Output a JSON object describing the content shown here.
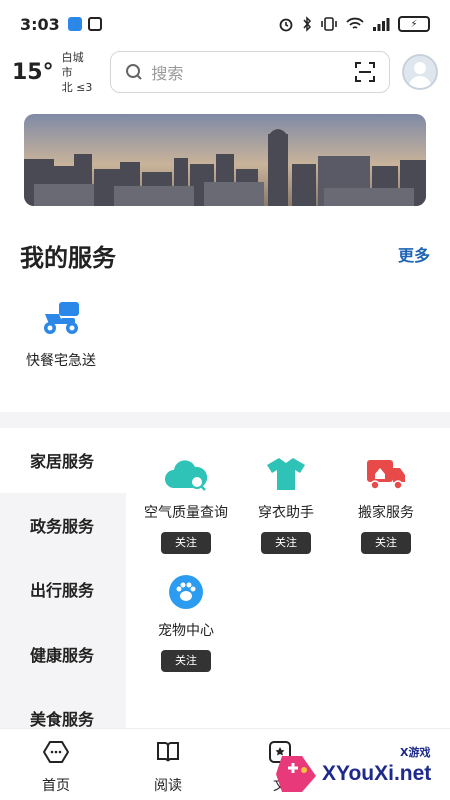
{
  "status_bar": {
    "time": "3:03",
    "battery": "⚡"
  },
  "header": {
    "temperature": "15°",
    "city": "白城市",
    "wind": "北 ≤3",
    "search_placeholder": "搜索"
  },
  "my_services": {
    "title": "我的服务",
    "more_label": "更多",
    "items": [
      {
        "label": "快餐宅急送",
        "icon": "delivery-scooter-icon"
      }
    ]
  },
  "categories": {
    "items": [
      {
        "label": "家居服务",
        "active": true
      },
      {
        "label": "政务服务",
        "active": false
      },
      {
        "label": "出行服务",
        "active": false
      },
      {
        "label": "健康服务",
        "active": false
      },
      {
        "label": "美食服务",
        "active": false
      }
    ]
  },
  "service_grid": {
    "follow_label": "关注",
    "items": [
      {
        "label": "空气质量查询",
        "icon": "air-quality-icon"
      },
      {
        "label": "穿衣助手",
        "icon": "tshirt-icon"
      },
      {
        "label": "搬家服务",
        "icon": "moving-truck-icon"
      },
      {
        "label": "宠物中心",
        "icon": "paw-icon"
      }
    ]
  },
  "bottom_nav": {
    "items": [
      {
        "label": "首页",
        "icon": "home-icon"
      },
      {
        "label": "阅读",
        "icon": "book-icon"
      },
      {
        "label": "文",
        "icon": "doc-icon"
      }
    ]
  },
  "watermark": {
    "text": "XYouXi.net",
    "small_text": "X游戏"
  },
  "colors": {
    "accent_blue": "#1e64b4",
    "service_teal": "#2fc3b8",
    "moving_red": "#e84a4a",
    "paw_blue": "#2c9cf0",
    "quick_blue": "#2c88e8",
    "follow_button": "#333333",
    "sidebar_bg": "#f4f4f6"
  }
}
